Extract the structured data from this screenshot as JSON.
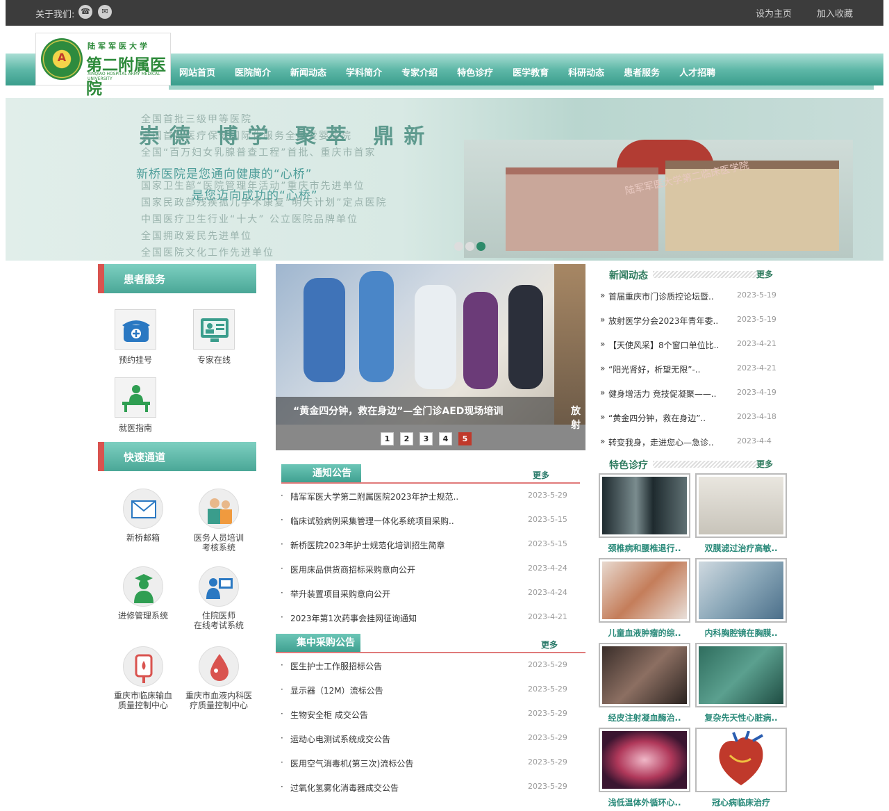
{
  "topbar": {
    "about": "关于我们:",
    "set_home": "设为主页",
    "favorite": "加入收藏"
  },
  "logo": {
    "line1": "陆军军医大学",
    "line2": "第二附属医院",
    "line3": "XINQIAO HOSPITAL ARMY MEDICAL UNIVERSITY"
  },
  "nav": [
    "网站首页",
    "医院简介",
    "新闻动态",
    "学科简介",
    "专家介绍",
    "特色诊疗",
    "医学教育",
    "科研动态",
    "患者服务",
    "人才招聘"
  ],
  "banner": {
    "slogan": "崇德 博学 聚萃 鼎新",
    "line_a": "新桥医院是您通向健康的“心桥”",
    "line_b": "是您迈向成功的“心桥”",
    "honors": [
      "全国首批三级甲等医院",
      "全国首批医疗保健国际化服务全国爱婴医院",
      "全国“百万妇女乳腺普查工程”首批、重庆市首家",
      "国家卫生部“医院管理年活动”重庆市先进单位",
      "国家民政部残疾孤儿手术康复“明天计划”定点医院",
      "中国医疗卫生行业“十大” 公立医院品牌单位",
      "全国拥政爱民先进单位",
      "全国医院文化工作先进单位"
    ],
    "wall_text": "陆军军医大学第二临床医学院"
  },
  "patient_service": {
    "title": "患者服务",
    "items": [
      "预约挂号",
      "专家在线",
      "就医指南"
    ]
  },
  "quick": {
    "title": "快速通道",
    "items": [
      {
        "l1": "新桥邮箱",
        "l2": ""
      },
      {
        "l1": "医务人员培训",
        "l2": "考核系统"
      },
      {
        "l1": "进修管理系统",
        "l2": ""
      },
      {
        "l1": "住院医师",
        "l2": "在线考试系统"
      },
      {
        "l1": "重庆市临床输血",
        "l2": "质量控制中心"
      },
      {
        "l1": "重庆市血液内科医",
        "l2": "疗质量控制中心"
      }
    ]
  },
  "slider": {
    "caption": "“黄金四分钟，救在身边”—全门诊AED现场培训",
    "caption2": "放射",
    "pages": [
      "1",
      "2",
      "3",
      "4",
      "5"
    ],
    "active_page": "5"
  },
  "notice": {
    "title": "通知公告",
    "more": "更多",
    "rows": [
      {
        "t": "陆军军医大学第二附属医院2023年护士规范..",
        "d": "2023-5-29"
      },
      {
        "t": "临床试验病例采集管理一体化系统项目采购..",
        "d": "2023-5-15"
      },
      {
        "t": "新桥医院2023年护士规范化培训招生简章",
        "d": "2023-5-15"
      },
      {
        "t": "医用床品供货商招标采购意向公开",
        "d": "2023-4-24"
      },
      {
        "t": "举升装置项目采购意向公开",
        "d": "2023-4-24"
      },
      {
        "t": "2023年第1次药事会挂网征询通知",
        "d": "2023-4-21"
      }
    ]
  },
  "purchase": {
    "title": "集中采购公告",
    "more": "更多",
    "rows": [
      {
        "t": "医生护士工作服招标公告",
        "d": "2023-5-29"
      },
      {
        "t": "显示器（12M）流标公告",
        "d": "2023-5-29"
      },
      {
        "t": "生物安全柜 成交公告",
        "d": "2023-5-29"
      },
      {
        "t": "运动心电测试系统成交公告",
        "d": "2023-5-29"
      },
      {
        "t": "医用空气消毒机(第三次)流标公告",
        "d": "2023-5-29"
      },
      {
        "t": "过氧化氢雾化消毒器成交公告",
        "d": "2023-5-29"
      }
    ]
  },
  "news": {
    "title": "新闻动态",
    "more": "更多",
    "rows": [
      {
        "t": "首届重庆市门诊质控论坛暨..",
        "d": "2023-5-19"
      },
      {
        "t": "放射医学分会2023年青年委..",
        "d": "2023-5-19"
      },
      {
        "t": "【天使风采】8个窗口单位比..",
        "d": "2023-4-21"
      },
      {
        "t": "“阳光肾好，析望无限”-..",
        "d": "2023-4-21"
      },
      {
        "t": "健身增活力 竞技促凝聚——..",
        "d": "2023-4-19"
      },
      {
        "t": "“黄金四分钟，救在身边”..",
        "d": "2023-4-18"
      },
      {
        "t": "转变我身，走进您心—急诊..",
        "d": "2023-4-4"
      }
    ]
  },
  "special": {
    "title": "特色诊疗",
    "more": "更多",
    "tiles": [
      "颈椎病和腰椎退行..",
      "双膜滤过治疗高敏..",
      "儿童血液肿瘤的综..",
      "内科胸腔镜在胸膜..",
      "经皮注射凝血酶治..",
      "复杂先天性心脏病..",
      "浅低温体外循环心..",
      "冠心病临床治疗"
    ]
  }
}
